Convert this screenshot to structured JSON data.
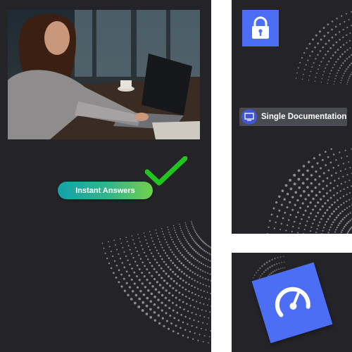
{
  "left_panel": {
    "photo": {
      "subject": "person-typing-on-laptop"
    },
    "pill": {
      "label": "Instant Answers"
    },
    "check_icon": "check-icon",
    "colors": {
      "pill_start": "#13a2a8",
      "pill_end": "#6fd24a",
      "check": "#22c51e"
    }
  },
  "top_right_panel": {
    "lock_icon": "lock-icon",
    "badge": {
      "label": "Single Documentation",
      "icon": "monitor-icon"
    },
    "colors": {
      "tile": "#4c6ef5"
    }
  },
  "bottom_right_panel": {
    "speed_icon": "speedometer-icon",
    "colors": {
      "tile": "#4c6ef5"
    }
  },
  "colors": {
    "panel_bg": "#232328",
    "page_bg": "#ffffff"
  }
}
